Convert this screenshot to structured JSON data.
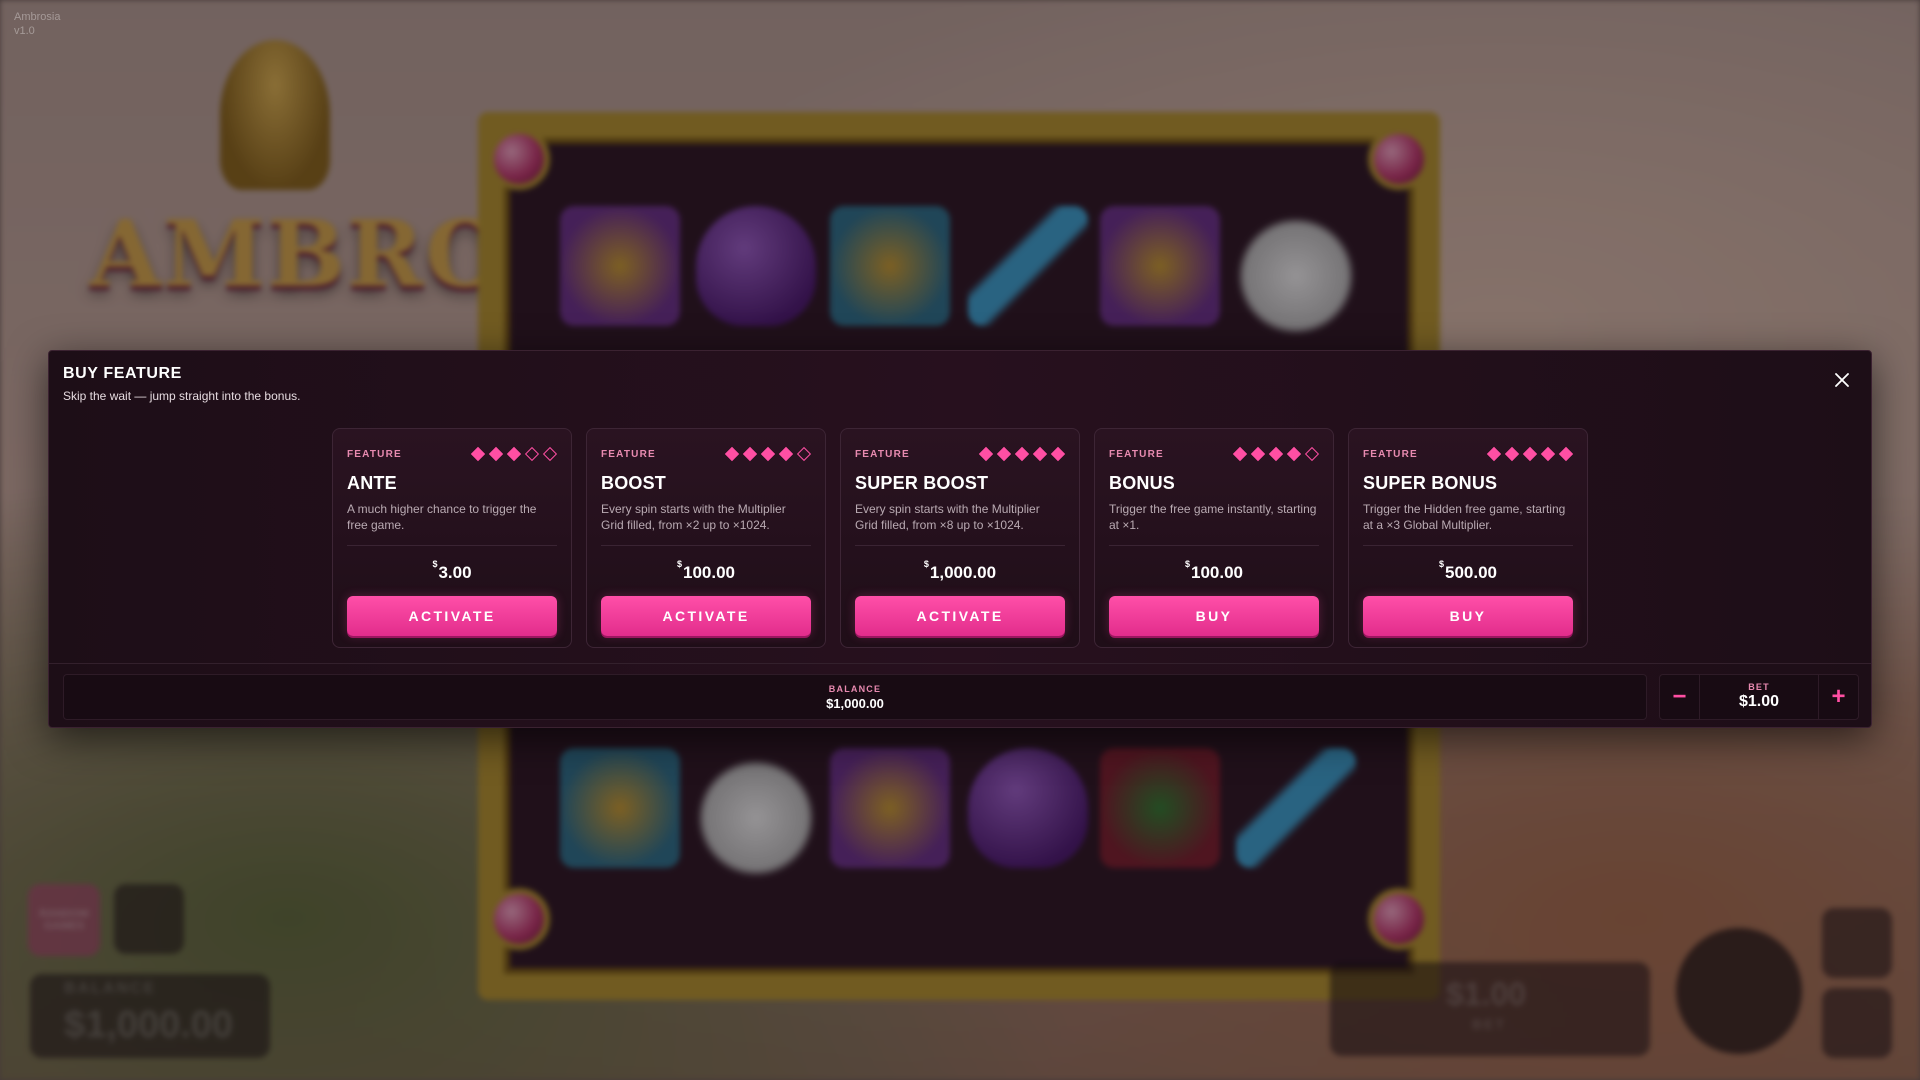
{
  "background": {
    "game_logo": "AMBROSIA",
    "brand_badge": "RANDOM GAMES",
    "balance_label": "BALANCE",
    "balance_value": "$1,000.00",
    "bet_value": "$1.00",
    "bet_label": "BET",
    "corner_line1": "Ambrosia",
    "corner_line2": "v1.0"
  },
  "modal": {
    "title": "BUY FEATURE",
    "subtitle": "Skip the wait — jump straight into the bonus.",
    "close_icon": "close-icon",
    "cards": [
      {
        "tag": "FEATURE",
        "name": "ANTE",
        "description": "A much higher chance to trigger the free game.",
        "currency": "$",
        "price": "3.00",
        "button": "ACTIVATE",
        "rating_filled": 3,
        "rating_total": 5
      },
      {
        "tag": "FEATURE",
        "name": "BOOST",
        "description": "Every spin starts with the Multiplier Grid filled, from ×2 up to ×1024.",
        "currency": "$",
        "price": "100.00",
        "button": "ACTIVATE",
        "rating_filled": 4,
        "rating_total": 5
      },
      {
        "tag": "FEATURE",
        "name": "SUPER BOOST",
        "description": "Every spin starts with the Multiplier Grid filled, from ×8 up to ×1024.",
        "currency": "$",
        "price": "1,000.00",
        "button": "ACTIVATE",
        "rating_filled": 5,
        "rating_total": 5
      },
      {
        "tag": "FEATURE",
        "name": "BONUS",
        "description": "Trigger the free game instantly, starting at ×1.",
        "currency": "$",
        "price": "100.00",
        "button": "BUY",
        "rating_filled": 4,
        "rating_total": 5
      },
      {
        "tag": "FEATURE",
        "name": "SUPER BONUS",
        "description": "Trigger the Hidden free game, starting at a ×3 Global Multiplier.",
        "currency": "$",
        "price": "500.00",
        "button": "BUY",
        "rating_filled": 5,
        "rating_total": 5
      }
    ],
    "balance_label": "BALANCE",
    "balance_value": "$1,000.00",
    "bet_label": "BET",
    "bet_value": "$1.00",
    "bet_minus": "−",
    "bet_plus": "+"
  },
  "colors": {
    "accent": "#ff4fa3",
    "button_top": "#ff4fa8",
    "button_bottom": "#e22d8c",
    "modal_bg": "#1d0e17"
  }
}
